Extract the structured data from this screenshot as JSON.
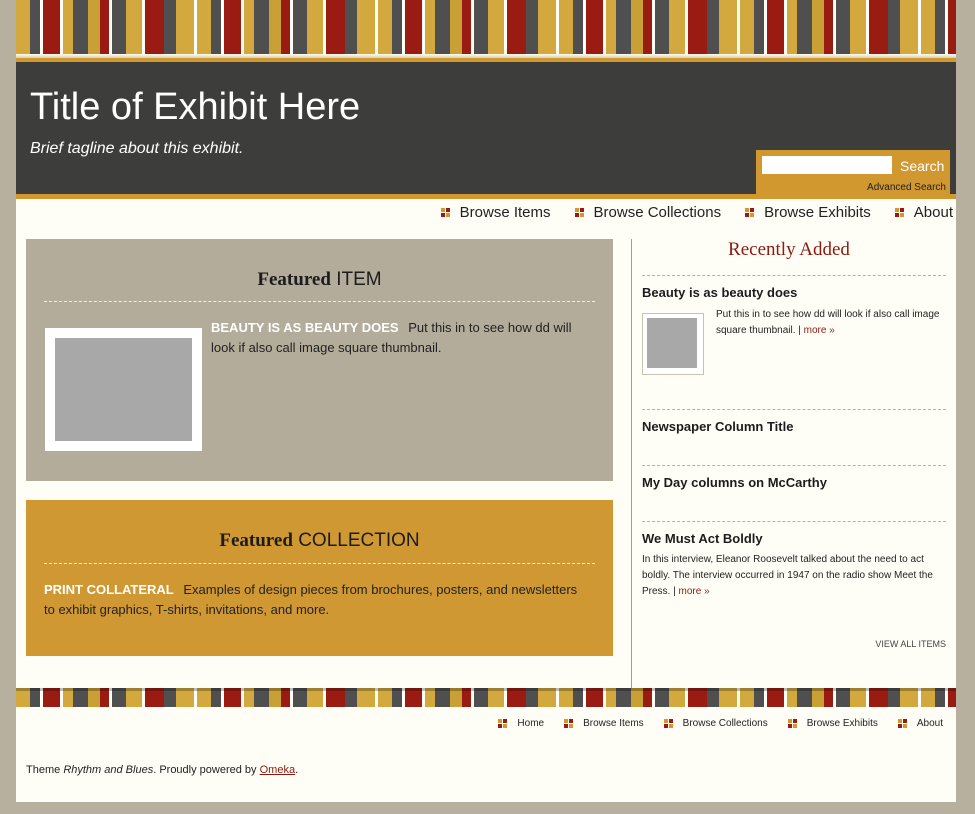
{
  "header": {
    "title": "Title of Exhibit Here",
    "tagline": "Brief tagline about this exhibit.",
    "search_button": "Search",
    "advanced_search": "Advanced Search"
  },
  "main_nav": [
    "Browse Items",
    "Browse Collections",
    "Browse Exhibits",
    "About"
  ],
  "featured_item": {
    "heading_bold": "Featured",
    "heading_rest": "ITEM",
    "item_title": "BEAUTY IS AS BEAUTY DOES",
    "description": "Put this in to see how dd will look if also call image square thumbnail."
  },
  "featured_collection": {
    "heading_bold": "Featured",
    "heading_rest": "COLLECTION",
    "collection_title": "PRINT COLLATERAL",
    "description": "Examples of design pieces from brochures, posters, and newsletters to exhibit graphics, T-shirts, invitations, and more."
  },
  "sidebar": {
    "title": "Recently Added",
    "items": [
      {
        "title": "Beauty is as beauty does",
        "description": "Put this in to see how dd will look if also call image square thumbnail.",
        "more": "more »"
      },
      {
        "title": "Newspaper Column Title"
      },
      {
        "title": "My Day columns on McCarthy"
      },
      {
        "title": "We Must Act Boldly",
        "description": "In this interview, Eleanor Roosevelt talked about the need to act boldly. The interview occurred in 1947 on the radio show Meet the Press.",
        "more": "more »"
      }
    ],
    "view_all": "VIEW ALL ITEMS"
  },
  "footer_nav": [
    "Home",
    "Browse Items",
    "Browse Collections",
    "Browse Exhibits",
    "About"
  ],
  "footer": {
    "theme_prefix": "Theme",
    "theme_name": "Rhythm and Blues",
    "powered_text": ". Proudly powered by",
    "powered_link": "Omeka",
    "end": "."
  },
  "colors": {
    "header_bg": "#3d3d3b",
    "accent_gold": "#cf9832",
    "accent_red": "#9a1b12",
    "featured_item_bg": "#b3ac9b",
    "page_bg": "#fffef6"
  }
}
